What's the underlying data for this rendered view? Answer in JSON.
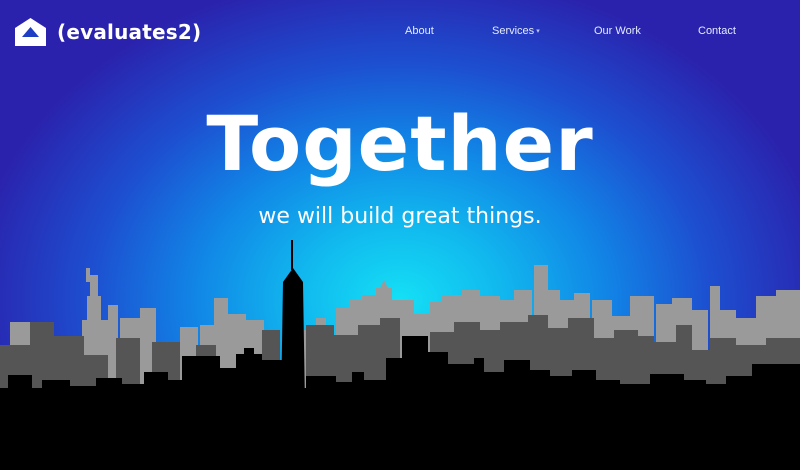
{
  "brand": {
    "name": "(evaluates2)",
    "logo_icon": "house-icon"
  },
  "nav": {
    "items": [
      {
        "label": "About",
        "has_dropdown": false
      },
      {
        "label": "Services",
        "has_dropdown": true,
        "dropdown_icon": "chevron-down-icon"
      },
      {
        "label": "Our Work",
        "has_dropdown": false
      },
      {
        "label": "Contact",
        "has_dropdown": false
      }
    ]
  },
  "hero": {
    "title": "Together",
    "subtitle": "we will build great things.",
    "background_image": "city-skyline-silhouette"
  },
  "colors": {
    "background_center": "#14e0f5",
    "background_edge": "#2a22ad",
    "text": "#ffffff",
    "skyline_back": "#9a9a9a",
    "skyline_mid": "#555555",
    "skyline_front": "#000000"
  }
}
